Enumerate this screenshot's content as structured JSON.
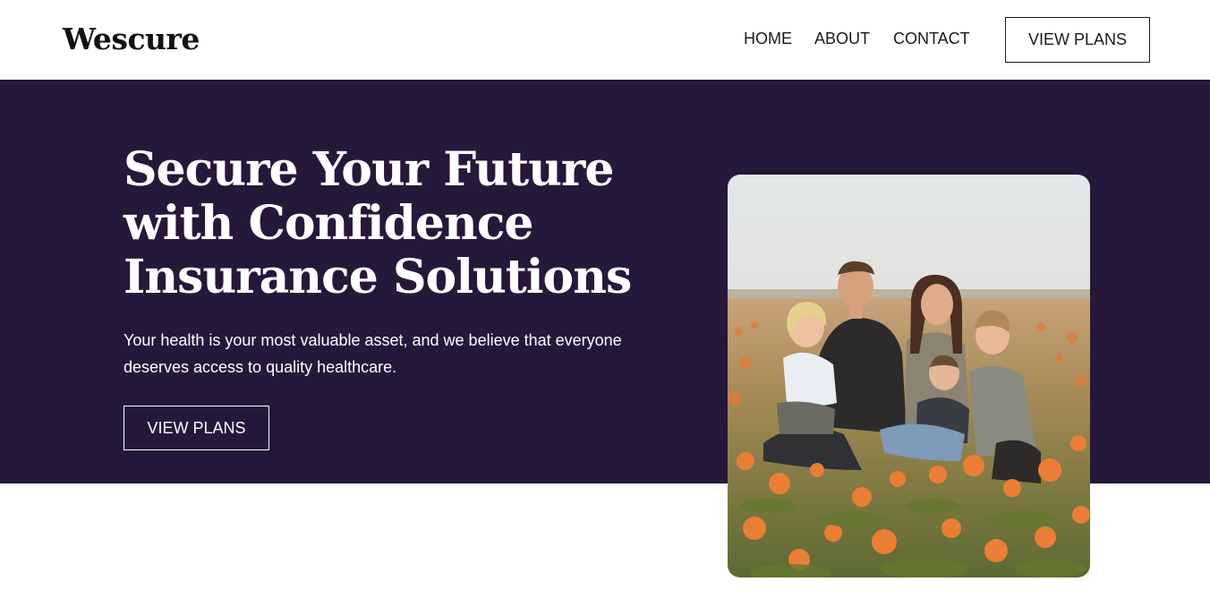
{
  "header": {
    "logo": "Wescure",
    "nav": [
      "HOME",
      "ABOUT",
      "CONTACT"
    ],
    "cta_label": "VIEW PLANS"
  },
  "hero": {
    "title": "Secure Your Future with Confidence Insurance Solutions",
    "subtitle": "Your health is your most valuable asset, and we believe that everyone deserves access to quality healthcare.",
    "cta_label": "VIEW PLANS",
    "image_icon": "family-photo-image"
  },
  "colors": {
    "hero_bg": "#26183a",
    "text_dark": "#111111",
    "white": "#ffffff"
  }
}
